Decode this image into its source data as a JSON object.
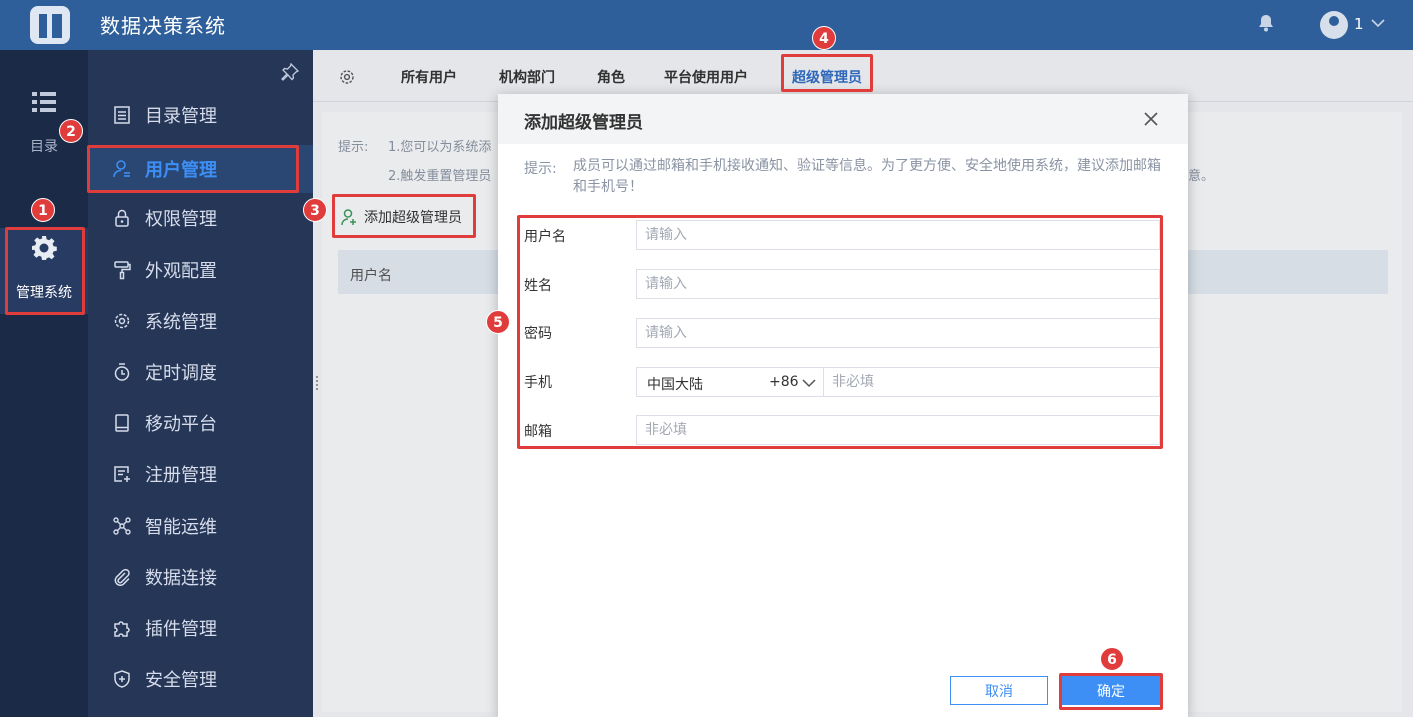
{
  "header": {
    "app_title": "数据决策系统",
    "user_name": "1"
  },
  "rail": {
    "items": [
      {
        "label": "目录",
        "icon": "list-icon"
      },
      {
        "label": "管理系统",
        "icon": "gear-icon",
        "active": true
      }
    ]
  },
  "nav": {
    "items": [
      {
        "label": "目录管理",
        "icon": "directory-icon"
      },
      {
        "label": "用户管理",
        "icon": "user-icon",
        "active": true
      },
      {
        "label": "权限管理",
        "icon": "lock-icon"
      },
      {
        "label": "外观配置",
        "icon": "paint-roller-icon"
      },
      {
        "label": "系统管理",
        "icon": "gear-icon"
      },
      {
        "label": "定时调度",
        "icon": "stopwatch-icon"
      },
      {
        "label": "移动平台",
        "icon": "tablet-icon"
      },
      {
        "label": "注册管理",
        "icon": "register-icon"
      },
      {
        "label": "智能运维",
        "icon": "network-icon"
      },
      {
        "label": "数据连接",
        "icon": "paperclip-icon"
      },
      {
        "label": "插件管理",
        "icon": "puzzle-icon"
      },
      {
        "label": "安全管理",
        "icon": "shield-icon"
      }
    ]
  },
  "tabs": [
    {
      "label": "所有用户"
    },
    {
      "label": "机构部门"
    },
    {
      "label": "角色"
    },
    {
      "label": "平台使用用户"
    },
    {
      "label": "超级管理员",
      "active": true
    }
  ],
  "page": {
    "tip_label": "提示:",
    "tip_line1": "1.您可以为系统添",
    "tip_line2": "2.触发重置管理员",
    "tip_tail": "意。",
    "add_button": "添加超级管理员",
    "table_header_username": "用户名"
  },
  "dialog": {
    "title": "添加超级管理员",
    "tip_label": "提示:",
    "tip_text": "成员可以通过邮箱和手机接收通知、验证等信息。为了更方便、安全地使用系统，建议添加邮箱和手机号！",
    "fields": {
      "username_label": "用户名",
      "username_placeholder": "请输入",
      "realname_label": "姓名",
      "realname_placeholder": "请输入",
      "password_label": "密码",
      "password_placeholder": "请输入",
      "phone_label": "手机",
      "phone_region": "中国大陆",
      "phone_code": "+86",
      "phone_placeholder": "非必填",
      "email_label": "邮箱",
      "email_placeholder": "非必填"
    },
    "cancel_label": "取消",
    "confirm_label": "确定"
  },
  "annotations": {
    "badges": [
      "1",
      "2",
      "3",
      "4",
      "5",
      "6"
    ],
    "color": "#e03c3c"
  },
  "colors": {
    "topbar": "#2f5f9a",
    "sidebar": "#253656",
    "rail": "#1b2a47",
    "accent": "#3d8ff5"
  }
}
